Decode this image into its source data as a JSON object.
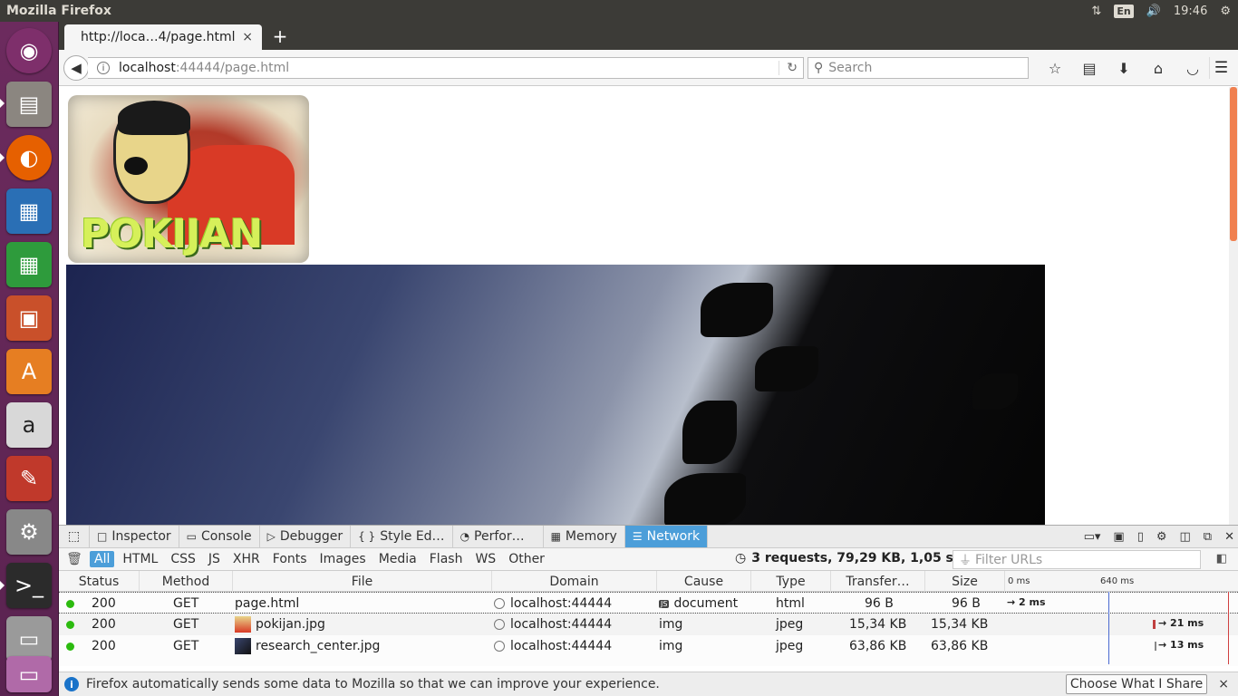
{
  "system": {
    "window_title": "Mozilla Firefox",
    "keyboard_layout": "En",
    "clock": "19:46"
  },
  "launcher": {
    "items": [
      {
        "name": "ubuntu-dash",
        "color": "#7e2f6b"
      },
      {
        "name": "files",
        "color": "#8b8680"
      },
      {
        "name": "firefox",
        "color": "#e66000"
      },
      {
        "name": "libreoffice-writer",
        "color": "#2a6fb5"
      },
      {
        "name": "libreoffice-calc",
        "color": "#2e9b3c"
      },
      {
        "name": "libreoffice-impress",
        "color": "#c9502a"
      },
      {
        "name": "software-center",
        "color": "#e67e22"
      },
      {
        "name": "amazon",
        "color": "#d8d8d8"
      },
      {
        "name": "system-settings",
        "color": "#c0392b"
      },
      {
        "name": "updates",
        "color": "#888888"
      },
      {
        "name": "terminal",
        "color": "#2b2b2b"
      },
      {
        "name": "drive",
        "color": "#9a9a9a"
      },
      {
        "name": "trash",
        "color": "#b06aa8"
      }
    ]
  },
  "tab": {
    "title": "http://loca…4/page.html",
    "close": "×",
    "new_tab": "+"
  },
  "navbar": {
    "url_host": "localhost",
    "url_rest": ":44444/page.html",
    "search_placeholder": "Search"
  },
  "content": {
    "logo_text": "POKIJAN"
  },
  "devtools": {
    "tabs": [
      {
        "label": "Inspector",
        "icon": "□"
      },
      {
        "label": "Console",
        "icon": "▭"
      },
      {
        "label": "Debugger",
        "icon": "▷"
      },
      {
        "label": "Style Ed…",
        "icon": "{ }"
      },
      {
        "label": "Perfor…",
        "icon": "◔"
      },
      {
        "label": "Memory",
        "icon": "▦"
      },
      {
        "label": "Network",
        "icon": "☰"
      }
    ],
    "filters": [
      "All",
      "HTML",
      "CSS",
      "JS",
      "XHR",
      "Fonts",
      "Images",
      "Media",
      "Flash",
      "WS",
      "Other"
    ],
    "summary": "3 requests, 79,29 KB, 1,05 s",
    "filter_placeholder": "Filter URLs",
    "columns": {
      "status": "Status",
      "method": "Method",
      "file": "File",
      "domain": "Domain",
      "cause": "Cause",
      "type": "Type",
      "transferred": "Transfer…",
      "size": "Size",
      "tick0": "0 ms",
      "tick1": "640 ms"
    },
    "requests": [
      {
        "status": "200",
        "method": "GET",
        "file": "page.html",
        "domain": "localhost:44444",
        "cause": "document",
        "type": "html",
        "transferred": "96 B",
        "size": "96 B",
        "timing": "→ 2 ms"
      },
      {
        "status": "200",
        "method": "GET",
        "file": "pokijan.jpg",
        "domain": "localhost:44444",
        "cause": "img",
        "type": "jpeg",
        "transferred": "15,34 KB",
        "size": "15,34 KB",
        "timing": "→ 21 ms"
      },
      {
        "status": "200",
        "method": "GET",
        "file": "research_center.jpg",
        "domain": "localhost:44444",
        "cause": "img",
        "type": "jpeg",
        "transferred": "63,86 KB",
        "size": "63,86 KB",
        "timing": "→ 13 ms"
      }
    ]
  },
  "notification": {
    "message": "Firefox automatically sends some data to Mozilla so that we can improve your experience.",
    "button": "Choose What I Share",
    "close": "×"
  }
}
